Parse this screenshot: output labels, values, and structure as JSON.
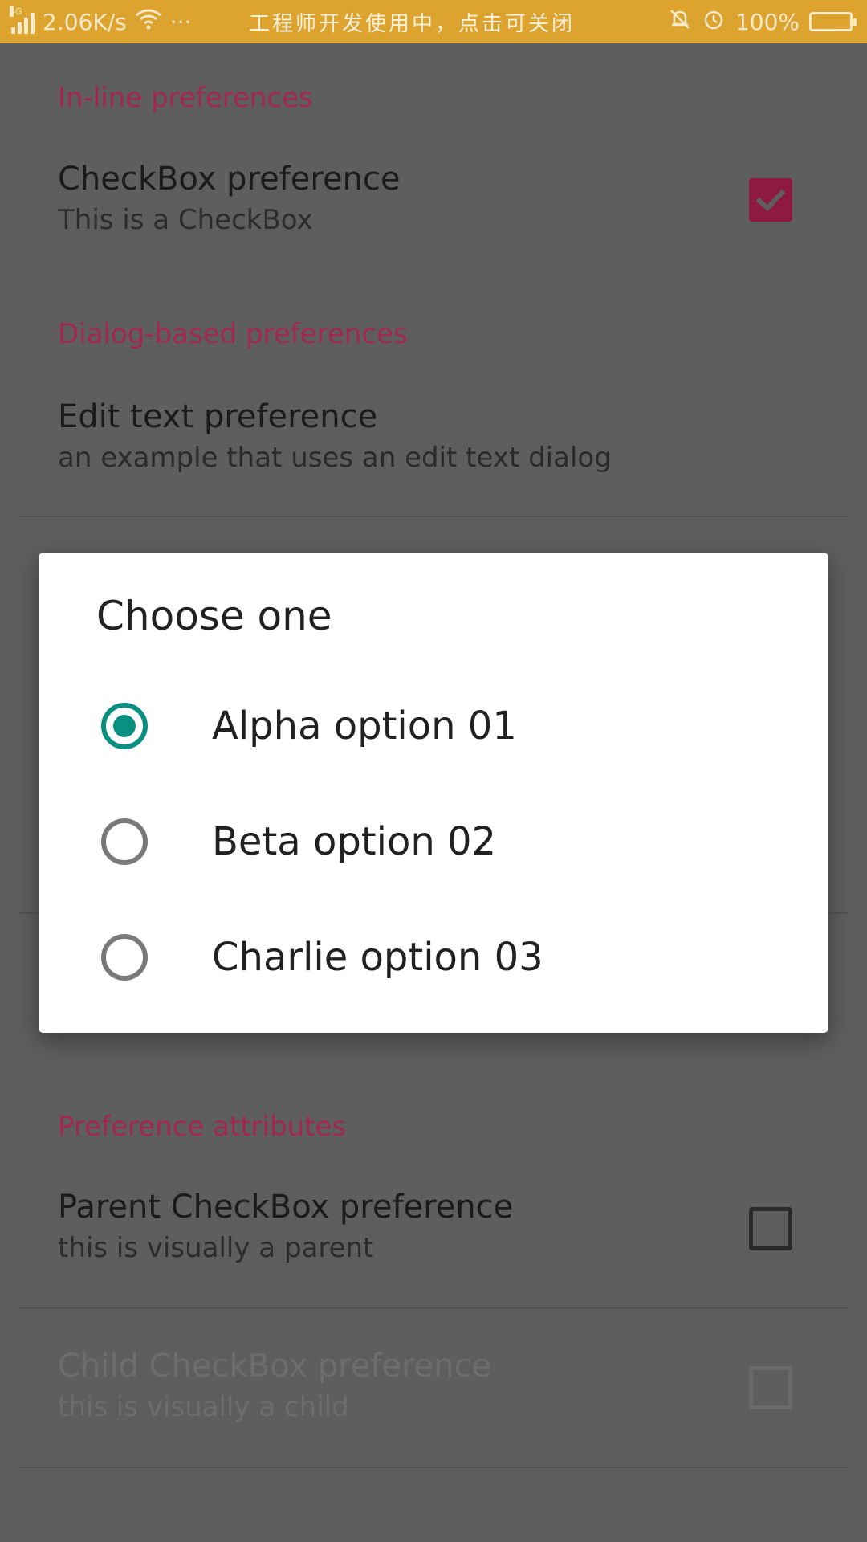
{
  "status_bar": {
    "network_type": "4G",
    "speed": "2.06K/s",
    "dots": "···",
    "center_text": "工程师开发使用中，点击可关闭",
    "battery_percent": "100%"
  },
  "preferences": {
    "inline_category": "In-line preferences",
    "checkbox_pref": {
      "title": "CheckBox preference",
      "summary": "This is a CheckBox",
      "checked": true
    },
    "dialog_category": "Dialog-based preferences",
    "edit_text_pref": {
      "title": "Edit text preference",
      "summary": "an example that uses an edit text dialog"
    },
    "attributes_category": "Preference attributes",
    "parent_checkbox_pref": {
      "title": "Parent CheckBox preference",
      "summary": "this is visually a parent",
      "checked": false
    },
    "child_checkbox_pref": {
      "title": "Child CheckBox preference",
      "summary": "this is visually a child",
      "checked": false,
      "enabled": false
    }
  },
  "dialog": {
    "title": "Choose one",
    "options": [
      {
        "label": "Alpha option 01",
        "selected": true
      },
      {
        "label": "Beta option 02",
        "selected": false
      },
      {
        "label": "Charlie option 03",
        "selected": false
      }
    ]
  },
  "colors": {
    "status_bar": "#dca32e",
    "accent": "#a3284f",
    "radio_selected": "#0a8f80",
    "scrim": "#5e5e5e"
  }
}
